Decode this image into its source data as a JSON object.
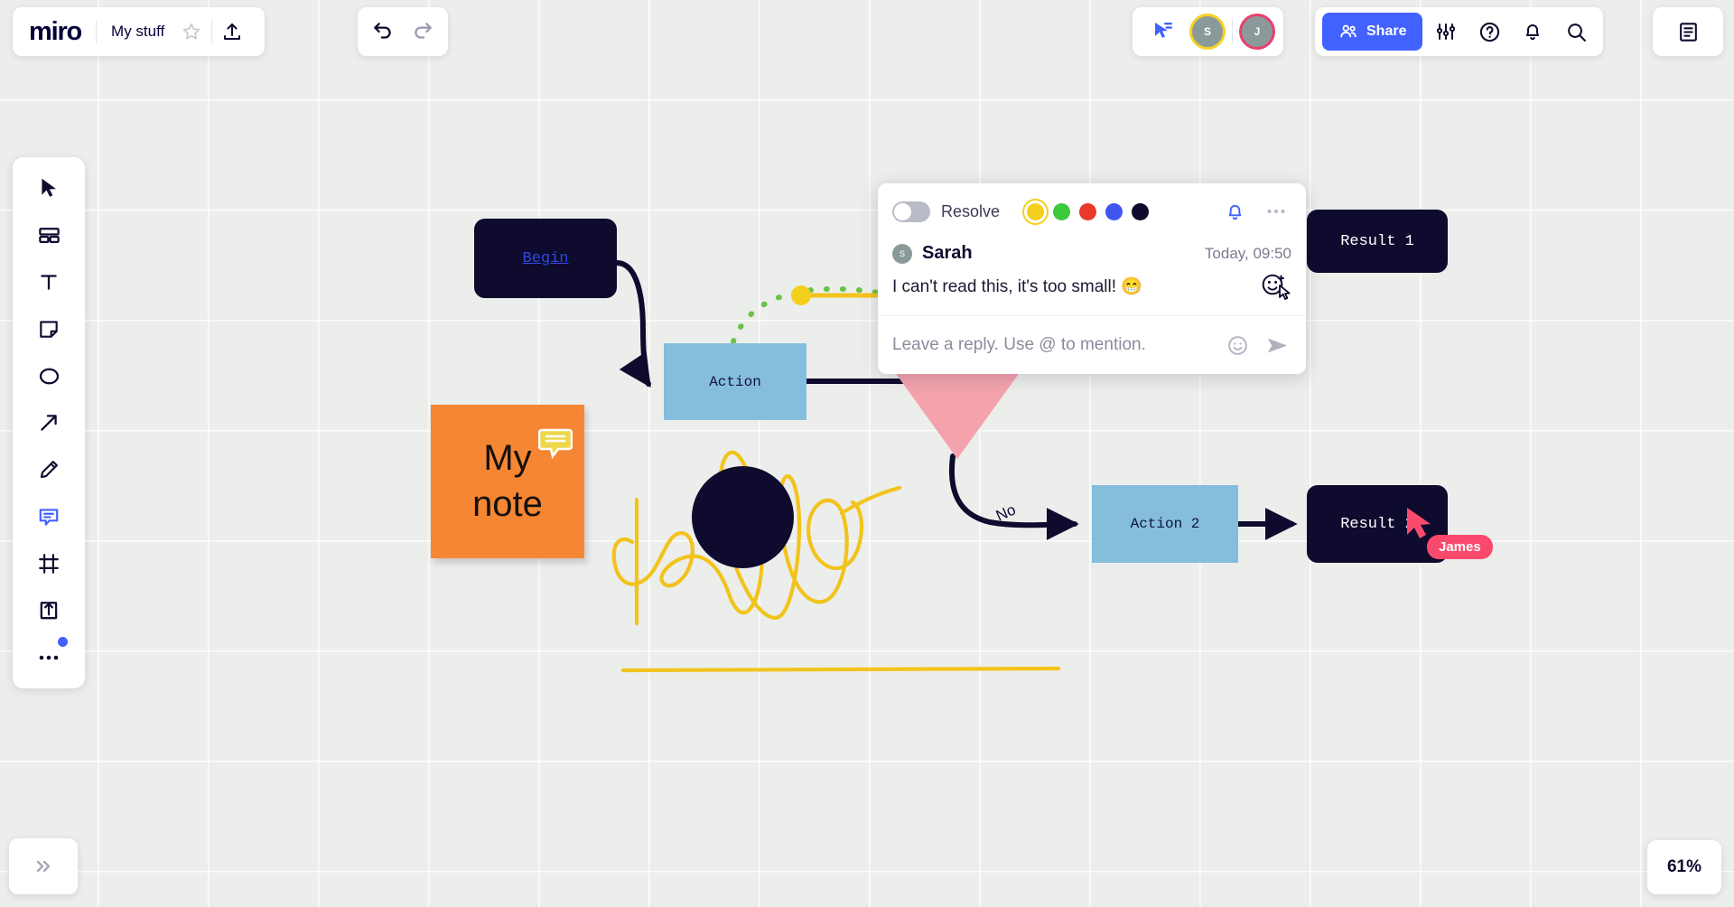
{
  "app": {
    "logo": "miro",
    "board_name": "My stuff"
  },
  "topbar": {
    "star_icon": "star-icon",
    "export_icon": "upload-export-icon",
    "undo_icon": "undo-icon",
    "redo_icon": "redo-icon",
    "cursor_share_icon": "cursor-share-icon",
    "share_label": "Share",
    "share_icon": "people-icon",
    "settings_icon": "sliders-icon",
    "help_icon": "help-circle-icon",
    "notifications_icon": "bell-icon",
    "search_icon": "search-icon",
    "notes_panel_icon": "document-panel-icon",
    "collaborators": [
      {
        "initial": "S",
        "ring": "#f5d226",
        "name": "sarah-avatar"
      },
      {
        "initial": "J",
        "ring": "#e8406b",
        "name": "james-avatar"
      }
    ]
  },
  "toolbar": {
    "items": [
      {
        "name": "select-tool",
        "icon": "cursor-icon",
        "active": false
      },
      {
        "name": "templates-tool",
        "icon": "templates-icon",
        "active": false
      },
      {
        "name": "text-tool",
        "icon": "text-icon",
        "active": false
      },
      {
        "name": "sticky-note-tool",
        "icon": "sticky-note-icon",
        "active": false
      },
      {
        "name": "shapes-tool",
        "icon": "circle-shape-icon",
        "active": false
      },
      {
        "name": "connector-tool",
        "icon": "arrow-icon",
        "active": false
      },
      {
        "name": "pen-tool",
        "icon": "pen-icon",
        "active": false
      },
      {
        "name": "comment-tool",
        "icon": "comment-icon",
        "active": true
      },
      {
        "name": "frame-tool",
        "icon": "frame-icon",
        "active": false
      },
      {
        "name": "upload-tool",
        "icon": "upload-icon",
        "active": false
      },
      {
        "name": "more-tools",
        "icon": "ellipsis-icon",
        "active": false
      }
    ]
  },
  "board": {
    "nodes": [
      {
        "name": "node-begin",
        "label": "Begin",
        "type": "terminator",
        "link": true
      },
      {
        "name": "node-action",
        "label": "Action",
        "type": "process"
      },
      {
        "name": "node-result-1",
        "label": "Result 1",
        "type": "terminator"
      },
      {
        "name": "node-action-2",
        "label": "Action 2",
        "type": "process"
      },
      {
        "name": "node-result-2",
        "label": "Result 2",
        "type": "terminator"
      },
      {
        "name": "node-decision",
        "label": "",
        "type": "decision"
      }
    ],
    "edge_labels": [
      {
        "name": "edge-label-no",
        "text": "No"
      }
    ],
    "sticky_note": {
      "line1": "My",
      "line2": "note",
      "color": "#f58634",
      "has_comment": true
    },
    "drawing": {
      "name": "handwriting-hello",
      "text": "hello",
      "color": "#f2c31c"
    },
    "remote_cursor": {
      "name": "james-cursor",
      "label": "James",
      "color": "#f94a6e"
    }
  },
  "comment": {
    "resolve_label": "Resolve",
    "resolved": false,
    "colors": [
      "#f5cf1e",
      "#3cc93c",
      "#e8392b",
      "#4155f0",
      "#0e0b2e"
    ],
    "selected_color": "#f5cf1e",
    "bell_icon": "bell-icon",
    "more_icon": "ellipsis-icon",
    "author": "Sarah",
    "author_initial": "S",
    "timestamp": "Today, 09:50",
    "text": "I can't read this, it's too small! 😁",
    "reaction_icon": "add-reaction-icon",
    "reply_placeholder": "Leave a reply. Use @ to mention.",
    "reply_value": "",
    "emoji_icon": "emoji-icon",
    "send_icon": "send-icon"
  },
  "bottom": {
    "expand_icon": "chevron-double-right-icon",
    "zoom_level": "61%"
  }
}
